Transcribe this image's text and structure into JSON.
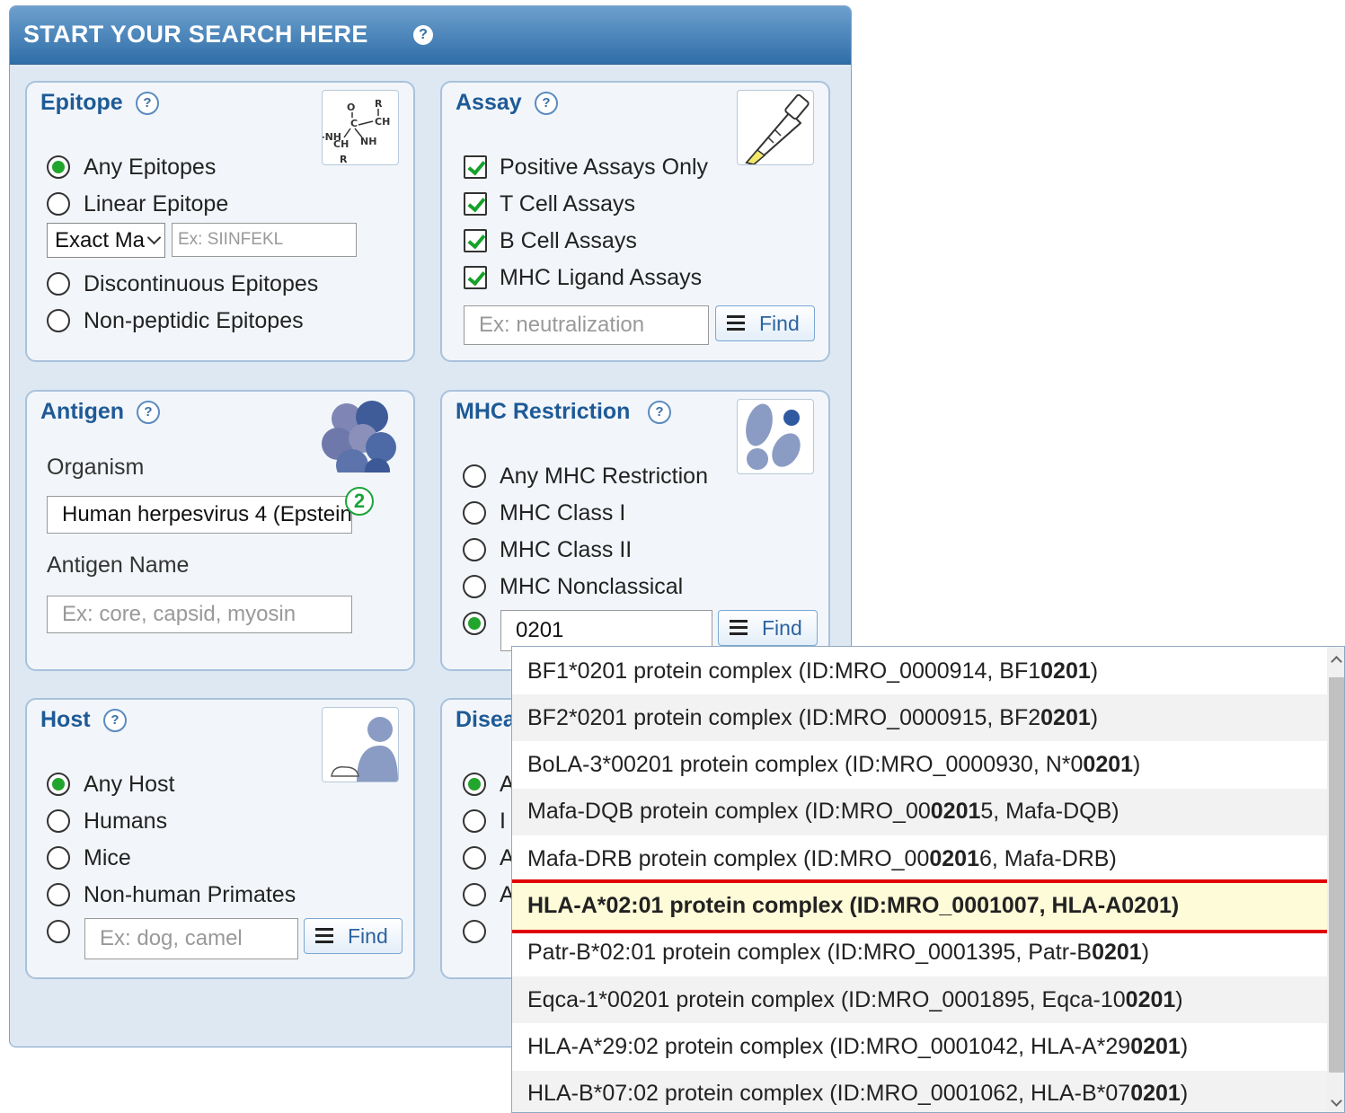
{
  "header": {
    "title": "START YOUR SEARCH HERE",
    "help": "?"
  },
  "epitope": {
    "title": "Epitope",
    "help": "?",
    "options": [
      "Any Epitopes",
      "Linear Epitope",
      "Discontinuous Epitopes",
      "Non-peptidic Epitopes"
    ],
    "selected": "Any Epitopes",
    "match_select": "Exact Ma",
    "sequence_placeholder": "Ex: SIINFEKL"
  },
  "assay": {
    "title": "Assay",
    "help": "?",
    "checks": [
      "Positive Assays Only",
      "T Cell Assays",
      "B Cell Assays",
      "MHC Ligand Assays"
    ],
    "input_placeholder": "Ex: neutralization",
    "find_label": "Find"
  },
  "antigen": {
    "title": "Antigen",
    "help": "?",
    "organism_label": "Organism",
    "organism_value": "Human herpesvirus 4 (Epstein",
    "organism_badge": "2",
    "name_label": "Antigen Name",
    "name_placeholder": "Ex: core, capsid, myosin"
  },
  "mhc": {
    "title": "MHC Restriction",
    "help": "?",
    "options": [
      "Any MHC Restriction",
      "MHC Class I",
      "MHC Class II",
      "MHC Nonclassical"
    ],
    "custom_value": "0201",
    "find_label": "Find"
  },
  "host": {
    "title": "Host",
    "help": "?",
    "options": [
      "Any Host",
      "Humans",
      "Mice",
      "Non-human Primates"
    ],
    "input_placeholder": "Ex: dog, camel",
    "find_label": "Find"
  },
  "disease": {
    "title": "Disea",
    "option_prefixes": [
      "A",
      "I",
      "A",
      "A"
    ]
  },
  "autocomplete": {
    "items": [
      [
        "BF1*0201 protein complex (ID:MRO_0000914, BF1",
        "0201",
        ")"
      ],
      [
        "BF2*0201 protein complex (ID:MRO_0000915, BF2",
        "0201",
        ")"
      ],
      [
        "BoLA-3*00201 protein complex (ID:MRO_0000930, N*0",
        "0201",
        ")"
      ],
      [
        "Mafa-DQB protein complex (ID:MRO_00",
        "0201",
        "5, Mafa-DQB)"
      ],
      [
        "Mafa-DRB protein complex (ID:MRO_00",
        "0201",
        "6, Mafa-DRB)"
      ],
      [
        "HLA-A*02:01 protein complex (ID:MRO_0001007, HLA-A",
        "0201",
        ")"
      ],
      [
        "Patr-B*02:01 protein complex (ID:MRO_0001395, Patr-B",
        "0201",
        ")"
      ],
      [
        "Eqca-1*00201 protein complex (ID:MRO_0001895, Eqca-10",
        "0201",
        ")"
      ],
      [
        "HLA-A*29:02 protein complex (ID:MRO_0001042, HLA-A*29",
        "0201",
        ")"
      ],
      [
        "HLA-B*07:02 protein complex (ID:MRO_0001062, HLA-B*07",
        "0201",
        ")"
      ]
    ],
    "highlighted_index": 5
  },
  "colors": {
    "accent": "#1e5a96",
    "header": "#2f6ea7",
    "check": "#16a22a",
    "highlight_border": "#e00000"
  }
}
